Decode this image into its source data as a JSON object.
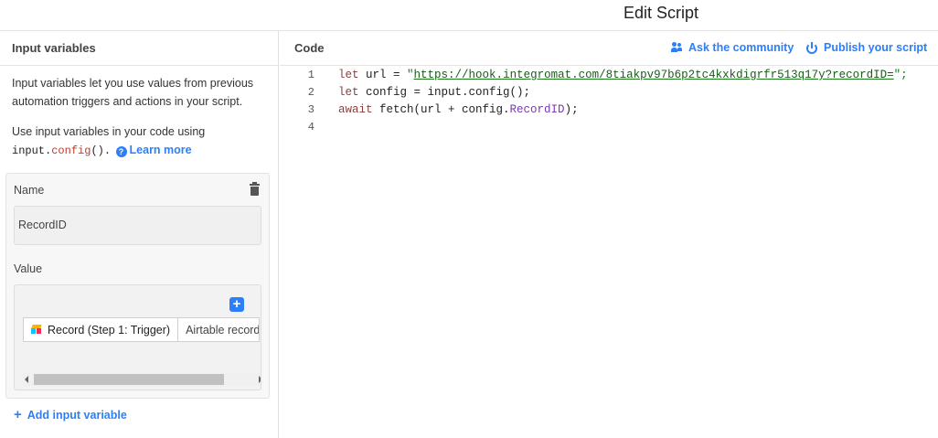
{
  "window": {
    "title": "Edit Script"
  },
  "input_panel": {
    "header": "Input variables",
    "description_1": "Input variables let you use values from previous automation triggers and actions in your script.",
    "description_2_prefix": "Use input variables in your code using",
    "code_input": "input",
    "code_dot": ".",
    "code_config": "config",
    "code_parens": "().",
    "learn_more": "Learn more",
    "variable": {
      "name_label": "Name",
      "name_value": "RecordID",
      "value_label": "Value",
      "tokens": [
        "Record (Step 1: Trigger)",
        "Airtable record"
      ]
    },
    "add_variable": "Add input variable"
  },
  "code_panel": {
    "header": "Code",
    "ask_community": "Ask the community",
    "publish_script": "Publish your script",
    "lines": [
      {
        "num": "1",
        "kw": "let",
        "text": " url = ",
        "str_open": "\"",
        "url": "https://hook.integromat.com/8tiakpv97b6p2tc4kxkdigrfr513q17y?recordID=",
        "str_close": "\";"
      },
      {
        "num": "2",
        "kw": "let",
        "text": " config = input.config();"
      },
      {
        "num": "3",
        "kw": "await",
        "text": " fetch(url + config.",
        "prop": "RecordID",
        "tail": ");"
      },
      {
        "num": "4"
      }
    ]
  },
  "colors": {
    "accent": "#2d7ff9",
    "keyword": "#8b3e3e",
    "string": "#1a7a1a",
    "property": "#7c3aad"
  }
}
